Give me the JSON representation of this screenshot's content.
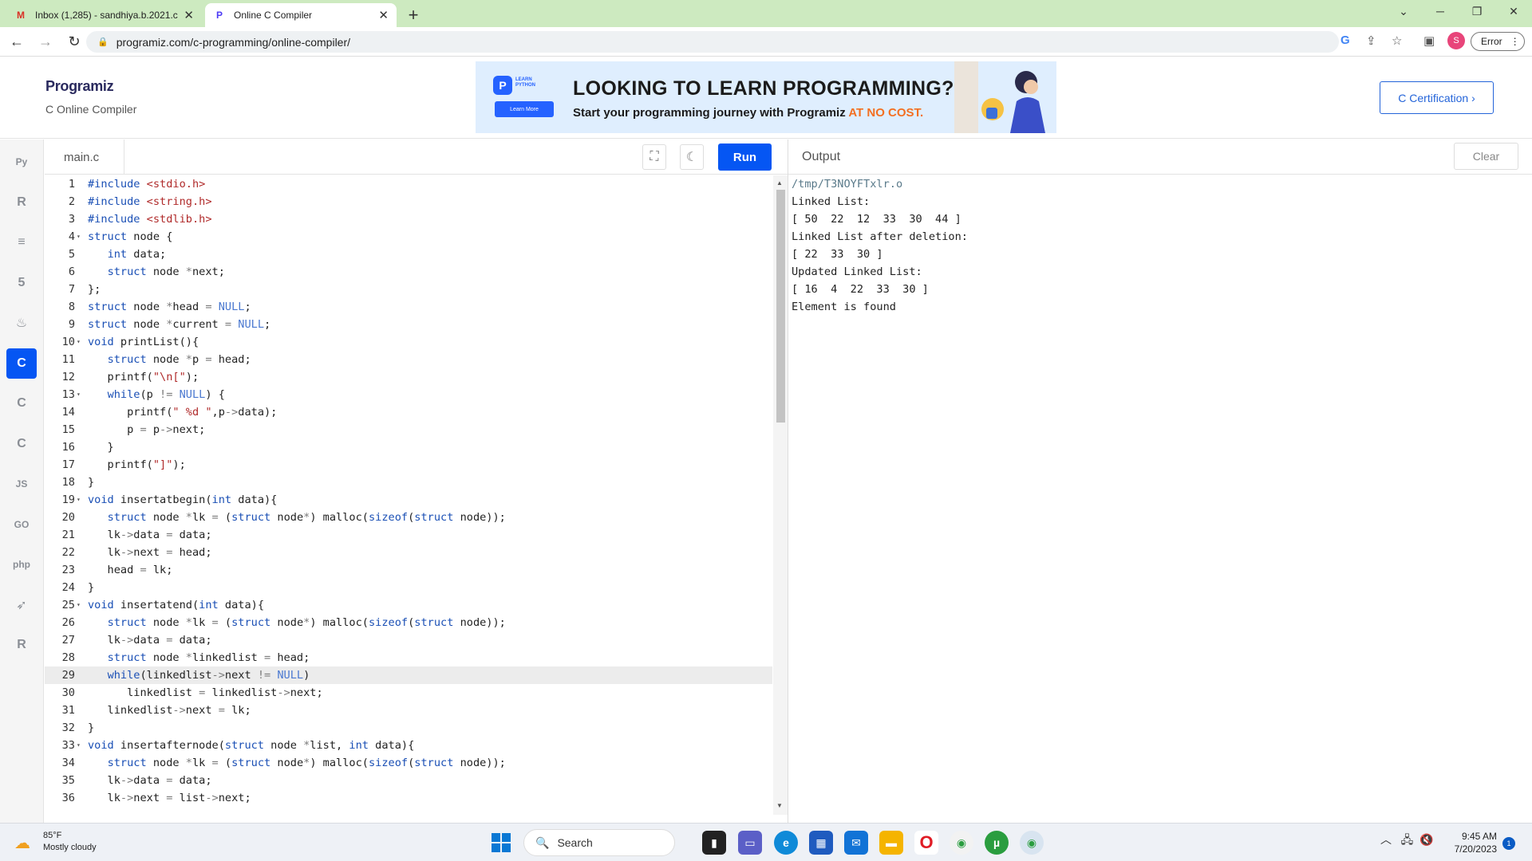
{
  "browser": {
    "tabs": [
      {
        "title": "Inbox (1,285) - sandhiya.b.2021.c",
        "icon": "gmail-icon",
        "active": false
      },
      {
        "title": "Online C Compiler",
        "icon": "programiz-icon",
        "active": true
      }
    ],
    "new_tab": "+",
    "url": "programiz.com/c-programming/online-compiler/",
    "profile_initial": "S",
    "error_label": "Error"
  },
  "site": {
    "logo": "Programiz",
    "subtitle": "C Online Compiler",
    "certification_button": "C Certification ›",
    "banner": {
      "badge": "LEARN PYTHON",
      "learn_more": "Learn More",
      "headline": "LOOKING TO LEARN PROGRAMMING?",
      "tagline_start": "Start your programming journey with Programiz ",
      "tagline_highlight": "AT NO COST."
    }
  },
  "sidebar": {
    "items": [
      {
        "name": "python",
        "label": "Py"
      },
      {
        "name": "r",
        "label": "R"
      },
      {
        "name": "sql",
        "label": "≡"
      },
      {
        "name": "html",
        "label": "5"
      },
      {
        "name": "java",
        "label": "♨"
      },
      {
        "name": "c",
        "label": "C",
        "active": true
      },
      {
        "name": "cpp",
        "label": "C"
      },
      {
        "name": "csharp",
        "label": "C"
      },
      {
        "name": "js",
        "label": "JS"
      },
      {
        "name": "go",
        "label": "GO"
      },
      {
        "name": "php",
        "label": "php"
      },
      {
        "name": "swift",
        "label": "➶"
      },
      {
        "name": "rust",
        "label": "R"
      }
    ]
  },
  "editor": {
    "filename": "main.c",
    "run_label": "Run",
    "active_line": 29,
    "lines": [
      "#include <stdio.h>",
      "#include <string.h>",
      "#include <stdlib.h>",
      "struct node {",
      "   int data;",
      "   struct node *next;",
      "};",
      "struct node *head = NULL;",
      "struct node *current = NULL;",
      "void printList(){",
      "   struct node *p = head;",
      "   printf(\"\\n[\");",
      "   while(p != NULL) {",
      "      printf(\" %d \",p->data);",
      "      p = p->next;",
      "   }",
      "   printf(\"]\");",
      "}",
      "void insertatbegin(int data){",
      "   struct node *lk = (struct node*) malloc(sizeof(struct node));",
      "   lk->data = data;",
      "   lk->next = head;",
      "   head = lk;",
      "}",
      "void insertatend(int data){",
      "   struct node *lk = (struct node*) malloc(sizeof(struct node));",
      "   lk->data = data;",
      "   struct node *linkedlist = head;",
      "   while(linkedlist->next != NULL)",
      "      linkedlist = linkedlist->next;",
      "   linkedlist->next = lk;",
      "}",
      "void insertafternode(struct node *list, int data){",
      "   struct node *lk = (struct node*) malloc(sizeof(struct node));",
      "   lk->data = data;",
      "   lk->next = list->next;"
    ],
    "folds": [
      4,
      10,
      13,
      19,
      25,
      33
    ]
  },
  "output": {
    "title": "Output",
    "clear_label": "Clear",
    "lines": [
      "/tmp/T3NOYFTxlr.o",
      "Linked List:",
      "[ 50  22  12  33  30  44 ]",
      "Linked List after deletion:",
      "[ 22  33  30 ]",
      "Updated Linked List:",
      "[ 16  4  22  33  30 ]",
      "Element is found"
    ]
  },
  "taskbar": {
    "temperature": "85°F",
    "weather": "Mostly cloudy",
    "search_placeholder": "Search",
    "time": "9:45 AM",
    "date": "7/20/2023",
    "notifications": "1"
  }
}
